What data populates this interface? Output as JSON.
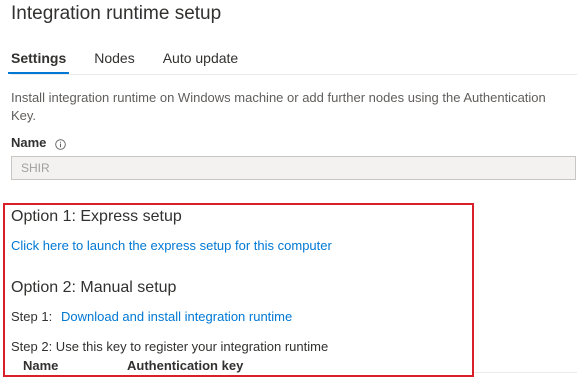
{
  "page": {
    "title": "Integration runtime setup"
  },
  "tabs": [
    {
      "label": "Settings",
      "active": true
    },
    {
      "label": "Nodes",
      "active": false
    },
    {
      "label": "Auto update",
      "active": false
    }
  ],
  "description": "Install integration runtime on Windows machine or add further nodes using the Authentication Key.",
  "name_field": {
    "label": "Name",
    "info_icon": "info-icon",
    "value": "SHIR"
  },
  "option1": {
    "heading": "Option 1: Express setup",
    "link": "Click here to launch the express setup for this computer"
  },
  "option2": {
    "heading": "Option 2: Manual setup",
    "step1_prefix": "Step 1:",
    "step1_link": "Download and install integration runtime",
    "step2": "Step 2: Use this key to register your integration runtime"
  },
  "keys_table": {
    "columns": [
      "Name",
      "Authentication key"
    ]
  },
  "colors": {
    "accent": "#0078d4",
    "highlight_border": "#d9202a"
  }
}
